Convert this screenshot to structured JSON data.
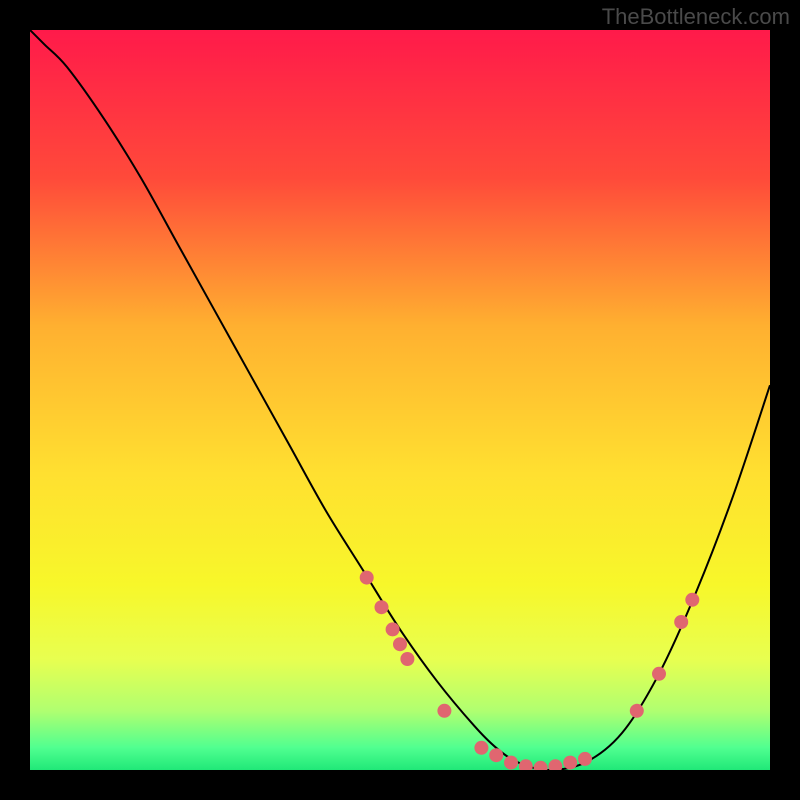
{
  "watermark": "TheBottleneck.com",
  "chart_data": {
    "type": "line",
    "title": "",
    "xlabel": "",
    "ylabel": "",
    "xlim": [
      0,
      100
    ],
    "ylim": [
      0,
      100
    ],
    "gradient_stops": [
      {
        "offset": 0,
        "color": "#ff1a4a"
      },
      {
        "offset": 20,
        "color": "#ff4a3a"
      },
      {
        "offset": 40,
        "color": "#ffb030"
      },
      {
        "offset": 60,
        "color": "#ffe030"
      },
      {
        "offset": 75,
        "color": "#f7f72a"
      },
      {
        "offset": 85,
        "color": "#e8ff50"
      },
      {
        "offset": 92,
        "color": "#b0ff70"
      },
      {
        "offset": 97,
        "color": "#50ff90"
      },
      {
        "offset": 100,
        "color": "#20e878"
      }
    ],
    "series": [
      {
        "name": "bottleneck-curve",
        "x": [
          0,
          2,
          5,
          10,
          15,
          20,
          25,
          30,
          35,
          40,
          45,
          50,
          55,
          60,
          63,
          66,
          70,
          75,
          80,
          85,
          90,
          95,
          100
        ],
        "y": [
          100,
          98,
          95,
          88,
          80,
          71,
          62,
          53,
          44,
          35,
          27,
          19,
          12,
          6,
          3,
          1,
          0,
          1,
          5,
          13,
          24,
          37,
          52
        ]
      }
    ],
    "markers": [
      {
        "x": 45.5,
        "y": 26
      },
      {
        "x": 47.5,
        "y": 22
      },
      {
        "x": 49,
        "y": 19
      },
      {
        "x": 50,
        "y": 17
      },
      {
        "x": 51,
        "y": 15
      },
      {
        "x": 56,
        "y": 8
      },
      {
        "x": 61,
        "y": 3
      },
      {
        "x": 63,
        "y": 2
      },
      {
        "x": 65,
        "y": 1
      },
      {
        "x": 67,
        "y": 0.5
      },
      {
        "x": 69,
        "y": 0.3
      },
      {
        "x": 71,
        "y": 0.5
      },
      {
        "x": 73,
        "y": 1
      },
      {
        "x": 75,
        "y": 1.5
      },
      {
        "x": 82,
        "y": 8
      },
      {
        "x": 85,
        "y": 13
      },
      {
        "x": 88,
        "y": 20
      },
      {
        "x": 89.5,
        "y": 23
      }
    ],
    "marker_color": "#e06670",
    "curve_color": "#000000"
  }
}
